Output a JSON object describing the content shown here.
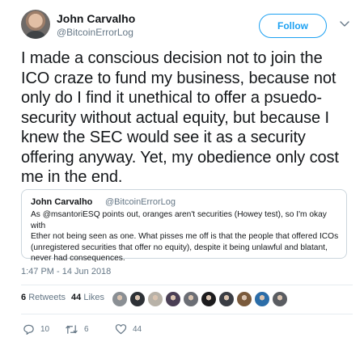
{
  "author": {
    "name": "John Carvalho",
    "handle": "@BitcoinErrorLog"
  },
  "follow_label": "Follow",
  "tweet": {
    "lines": [
      "I made a conscious decision not to join the",
      "ICO craze to fund my business, because not",
      "only do I find it unethical to offer a psuedo-",
      "security without actual equity, but because I",
      "knew the SEC would see it as a security",
      "offering anyway. Yet, my obedience only cost",
      "me in the end."
    ]
  },
  "quote": {
    "name": "John Carvalho",
    "handle": "@BitcoinErrorLog",
    "lines": [
      "As @msantoriESQ points out, oranges aren't securities (Howey test), so I'm okay with",
      "Ether not being seen as one. What pisses me off is that the people that offered ICOs",
      "(unregistered securities that offer no equity), despite it being unlawful and blatant,",
      "never had consequences."
    ]
  },
  "timestamp": "1:47 PM - 14 Jun 2018",
  "stats": {
    "retweets_count": "6",
    "retweets_label": "Retweets",
    "likes_count": "44",
    "likes_label": "Likes"
  },
  "likers_avatar_colors": [
    "#8a8f94",
    "#2d3136",
    "#b8b2a8",
    "#4a3f55",
    "#6b6e75",
    "#1c1c1e",
    "#3a3d44",
    "#7a5a3c",
    "#2b6da8",
    "#5a5d62"
  ],
  "actions": {
    "replies": "10",
    "retweets": "6",
    "likes": "44"
  },
  "colors": {
    "accent": "#1da1f2",
    "secondary_text": "#657786",
    "border": "#ccd6dd"
  }
}
